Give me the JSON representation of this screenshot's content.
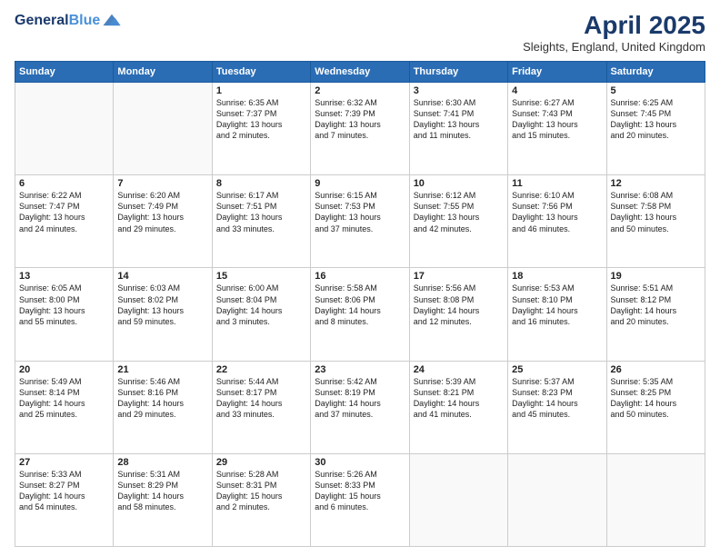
{
  "header": {
    "logo_line1": "General",
    "logo_line2": "Blue",
    "title": "April 2025",
    "subtitle": "Sleights, England, United Kingdom"
  },
  "days_of_week": [
    "Sunday",
    "Monday",
    "Tuesday",
    "Wednesday",
    "Thursday",
    "Friday",
    "Saturday"
  ],
  "weeks": [
    [
      {
        "day": "",
        "info": ""
      },
      {
        "day": "",
        "info": ""
      },
      {
        "day": "1",
        "info": "Sunrise: 6:35 AM\nSunset: 7:37 PM\nDaylight: 13 hours\nand 2 minutes."
      },
      {
        "day": "2",
        "info": "Sunrise: 6:32 AM\nSunset: 7:39 PM\nDaylight: 13 hours\nand 7 minutes."
      },
      {
        "day": "3",
        "info": "Sunrise: 6:30 AM\nSunset: 7:41 PM\nDaylight: 13 hours\nand 11 minutes."
      },
      {
        "day": "4",
        "info": "Sunrise: 6:27 AM\nSunset: 7:43 PM\nDaylight: 13 hours\nand 15 minutes."
      },
      {
        "day": "5",
        "info": "Sunrise: 6:25 AM\nSunset: 7:45 PM\nDaylight: 13 hours\nand 20 minutes."
      }
    ],
    [
      {
        "day": "6",
        "info": "Sunrise: 6:22 AM\nSunset: 7:47 PM\nDaylight: 13 hours\nand 24 minutes."
      },
      {
        "day": "7",
        "info": "Sunrise: 6:20 AM\nSunset: 7:49 PM\nDaylight: 13 hours\nand 29 minutes."
      },
      {
        "day": "8",
        "info": "Sunrise: 6:17 AM\nSunset: 7:51 PM\nDaylight: 13 hours\nand 33 minutes."
      },
      {
        "day": "9",
        "info": "Sunrise: 6:15 AM\nSunset: 7:53 PM\nDaylight: 13 hours\nand 37 minutes."
      },
      {
        "day": "10",
        "info": "Sunrise: 6:12 AM\nSunset: 7:55 PM\nDaylight: 13 hours\nand 42 minutes."
      },
      {
        "day": "11",
        "info": "Sunrise: 6:10 AM\nSunset: 7:56 PM\nDaylight: 13 hours\nand 46 minutes."
      },
      {
        "day": "12",
        "info": "Sunrise: 6:08 AM\nSunset: 7:58 PM\nDaylight: 13 hours\nand 50 minutes."
      }
    ],
    [
      {
        "day": "13",
        "info": "Sunrise: 6:05 AM\nSunset: 8:00 PM\nDaylight: 13 hours\nand 55 minutes."
      },
      {
        "day": "14",
        "info": "Sunrise: 6:03 AM\nSunset: 8:02 PM\nDaylight: 13 hours\nand 59 minutes."
      },
      {
        "day": "15",
        "info": "Sunrise: 6:00 AM\nSunset: 8:04 PM\nDaylight: 14 hours\nand 3 minutes."
      },
      {
        "day": "16",
        "info": "Sunrise: 5:58 AM\nSunset: 8:06 PM\nDaylight: 14 hours\nand 8 minutes."
      },
      {
        "day": "17",
        "info": "Sunrise: 5:56 AM\nSunset: 8:08 PM\nDaylight: 14 hours\nand 12 minutes."
      },
      {
        "day": "18",
        "info": "Sunrise: 5:53 AM\nSunset: 8:10 PM\nDaylight: 14 hours\nand 16 minutes."
      },
      {
        "day": "19",
        "info": "Sunrise: 5:51 AM\nSunset: 8:12 PM\nDaylight: 14 hours\nand 20 minutes."
      }
    ],
    [
      {
        "day": "20",
        "info": "Sunrise: 5:49 AM\nSunset: 8:14 PM\nDaylight: 14 hours\nand 25 minutes."
      },
      {
        "day": "21",
        "info": "Sunrise: 5:46 AM\nSunset: 8:16 PM\nDaylight: 14 hours\nand 29 minutes."
      },
      {
        "day": "22",
        "info": "Sunrise: 5:44 AM\nSunset: 8:17 PM\nDaylight: 14 hours\nand 33 minutes."
      },
      {
        "day": "23",
        "info": "Sunrise: 5:42 AM\nSunset: 8:19 PM\nDaylight: 14 hours\nand 37 minutes."
      },
      {
        "day": "24",
        "info": "Sunrise: 5:39 AM\nSunset: 8:21 PM\nDaylight: 14 hours\nand 41 minutes."
      },
      {
        "day": "25",
        "info": "Sunrise: 5:37 AM\nSunset: 8:23 PM\nDaylight: 14 hours\nand 45 minutes."
      },
      {
        "day": "26",
        "info": "Sunrise: 5:35 AM\nSunset: 8:25 PM\nDaylight: 14 hours\nand 50 minutes."
      }
    ],
    [
      {
        "day": "27",
        "info": "Sunrise: 5:33 AM\nSunset: 8:27 PM\nDaylight: 14 hours\nand 54 minutes."
      },
      {
        "day": "28",
        "info": "Sunrise: 5:31 AM\nSunset: 8:29 PM\nDaylight: 14 hours\nand 58 minutes."
      },
      {
        "day": "29",
        "info": "Sunrise: 5:28 AM\nSunset: 8:31 PM\nDaylight: 15 hours\nand 2 minutes."
      },
      {
        "day": "30",
        "info": "Sunrise: 5:26 AM\nSunset: 8:33 PM\nDaylight: 15 hours\nand 6 minutes."
      },
      {
        "day": "",
        "info": ""
      },
      {
        "day": "",
        "info": ""
      },
      {
        "day": "",
        "info": ""
      }
    ]
  ]
}
